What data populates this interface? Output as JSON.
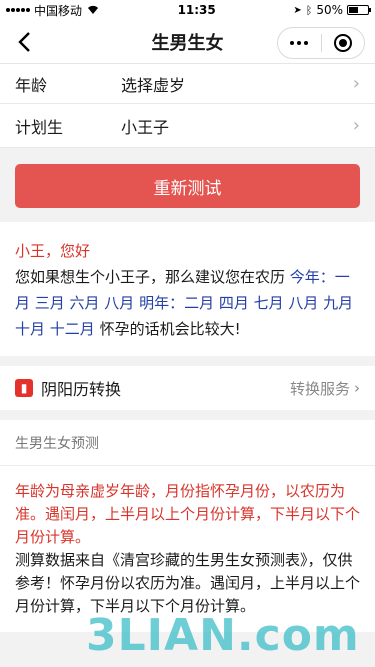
{
  "status_bar": {
    "carrier": "中国移动",
    "time": "11:35",
    "battery": "50%",
    "battery_level": 0.5
  },
  "nav": {
    "title": "生男生女"
  },
  "form": {
    "age_label": "年龄",
    "age_value": "选择虚岁",
    "plan_label": "计划生",
    "plan_value": "小王子"
  },
  "retest_label": "重新测试",
  "result": {
    "greeting": "小王，您好",
    "text_before": "您如果想生个小王子，那么建议您在农历",
    "this_year": "今年：一月 三月 六月 八月",
    "next_year": "明年：二月 四月 七月 八月 九月 十月 十二月",
    "text_after": "怀孕的话机会比较大!"
  },
  "service": {
    "name": "阴阳历转换",
    "action": "转换服务"
  },
  "predict": {
    "title": "生男生女预测",
    "note_red": "年龄为母亲虚岁年龄，月份指怀孕月份，以农历为准。遇闰月，上半月以上个月份计算，下半月以下个月份计算。",
    "note": "测算数据来自《清宫珍藏的生男生女预测表》，仅供参考！怀孕月份以农历为准。遇闰月，上半月以上个月份计算，下半月以下个月份计算。"
  },
  "watermark": "3LIAN.com",
  "colors": {
    "accent_red": "#e45450",
    "link_blue": "#2440a8"
  }
}
